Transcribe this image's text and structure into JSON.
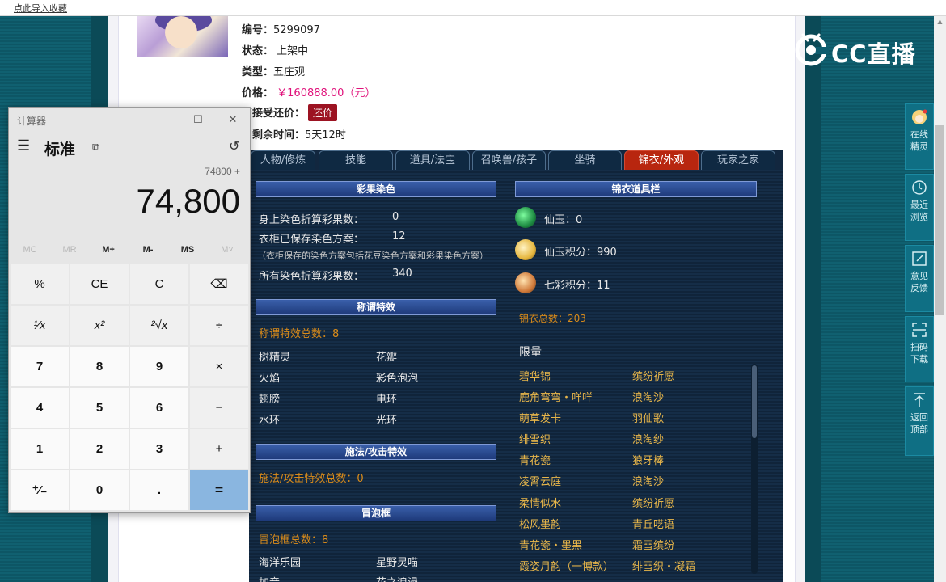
{
  "bookmark_bar": {
    "text": "点此导入收藏"
  },
  "listing": {
    "id_label": "编号：",
    "id_value": "5299097",
    "status_label": "状态：",
    "status_value": "上架中",
    "type_label": "类型：",
    "type_value": "五庄观",
    "price_label": "价格：",
    "price_value": "￥160888.00（元）",
    "haggle_label": "否接受还价：",
    "haggle_button": "还价",
    "remaining_label": "售剩余时间：",
    "remaining_value": "5天12时"
  },
  "tabs": [
    {
      "label": "人物/修炼",
      "active": false
    },
    {
      "label": "技能",
      "active": false
    },
    {
      "label": "道具/法宝",
      "active": false
    },
    {
      "label": "召唤兽/孩子",
      "active": false
    },
    {
      "label": "坐骑",
      "active": false
    },
    {
      "label": "锦衣/外观",
      "active": true
    },
    {
      "label": "玩家之家",
      "active": false
    }
  ],
  "dye": {
    "title": "彩果染色",
    "rows": [
      {
        "label": "身上染色折算彩果数：",
        "value": "0"
      },
      {
        "label": "衣柜已保存染色方案：",
        "value": "12"
      },
      {
        "label": "所有染色折算彩果数：",
        "value": "340"
      }
    ],
    "note": "（衣柜保存的染色方案包括花豆染色方案和彩果染色方案）"
  },
  "title_effects": {
    "title": "称谓特效",
    "total": "称谓特效总数：8",
    "items": [
      "树精灵",
      "花瓣",
      "火焰",
      "彩色泡泡",
      "翅膀",
      "电环",
      "水环",
      "光环"
    ]
  },
  "spell_effects": {
    "title": "施法/攻击特效",
    "total": "施法/攻击特效总数：0"
  },
  "bubble": {
    "title": "冒泡框",
    "total": "冒泡框总数：8",
    "items": [
      "海洋乐园",
      "星野灵喵",
      "加音",
      "花之浪漫"
    ]
  },
  "outfit_bar": {
    "title": "锦衣道具栏",
    "currencies": [
      {
        "label": "仙玉：0",
        "icon": "jade-icon"
      },
      {
        "label": "仙玉积分：990",
        "icon": "jade-points-icon"
      },
      {
        "label": "七彩积分：11",
        "icon": "rainbow-points-icon"
      }
    ],
    "total": "锦衣总数：203",
    "limited_label": "限量",
    "limited_items": [
      [
        "碧华锦",
        "缤纷祈愿"
      ],
      [
        "鹿角弯弯・咩咩",
        "浪淘沙"
      ],
      [
        "萌草发卡",
        "羽仙歌"
      ],
      [
        "绯雪织",
        "浪淘纱"
      ],
      [
        "青花瓷",
        "狼牙棒"
      ],
      [
        "凌霄云庭",
        "浪淘沙"
      ],
      [
        "柔情似水",
        "缤纷祈愿"
      ],
      [
        "松风墨韵",
        "青丘呓语"
      ],
      [
        "青花瓷・墨黑",
        "霜雪缤纷"
      ],
      [
        "霞姿月韵（一博款）",
        "绯雪织・凝霜"
      ]
    ]
  },
  "logo": {
    "text": "CC直播"
  },
  "sidebar": [
    {
      "label1": "在线",
      "label2": "精灵"
    },
    {
      "label1": "最近",
      "label2": "浏览"
    },
    {
      "label1": "意见",
      "label2": "反馈"
    },
    {
      "label1": "扫码",
      "label2": "下载"
    },
    {
      "label1": "返回",
      "label2": "顶部"
    }
  ],
  "calculator": {
    "window_title": "计算器",
    "mode": "标准",
    "expression": "74800 +",
    "display": "74,800",
    "memory": [
      {
        "label": "MC",
        "enabled": false
      },
      {
        "label": "MR",
        "enabled": false
      },
      {
        "label": "M+",
        "enabled": true
      },
      {
        "label": "M-",
        "enabled": true
      },
      {
        "label": "MS",
        "enabled": true
      },
      {
        "label": "M˅",
        "enabled": false
      }
    ],
    "keys": [
      [
        "%",
        "CE",
        "C",
        "⌫"
      ],
      [
        "¹⁄x",
        "x²",
        "²√x",
        "÷"
      ],
      [
        "7",
        "8",
        "9",
        "×"
      ],
      [
        "4",
        "5",
        "6",
        "−"
      ],
      [
        "1",
        "2",
        "3",
        "+"
      ],
      [
        "⁺⁄₋",
        "0",
        ".",
        "="
      ]
    ]
  },
  "colors": {
    "accent_tab": "#b8260f",
    "price": "#e0127b",
    "panel": "#12273f",
    "equals_key": "#8ab6e0"
  }
}
